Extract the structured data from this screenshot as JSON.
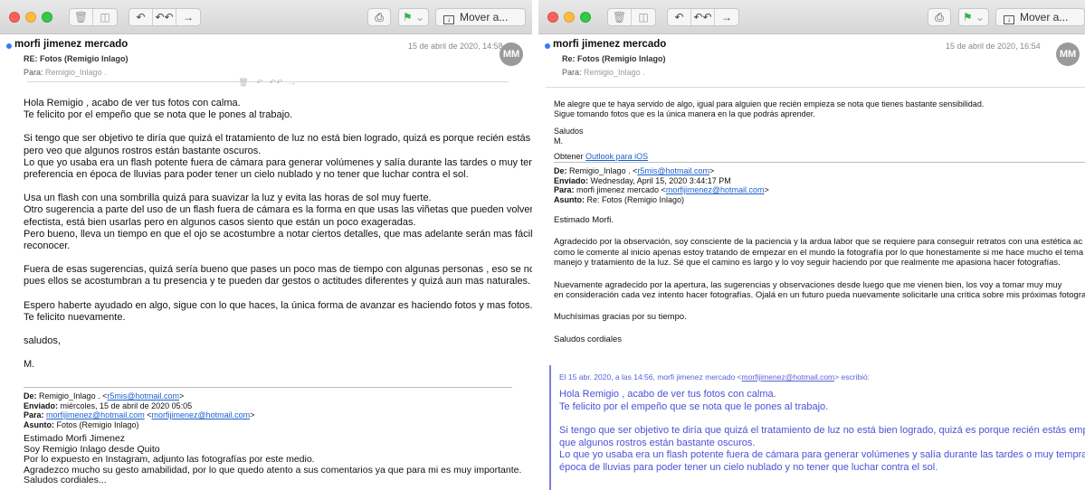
{
  "left": {
    "toolbar": {
      "move_label": "Mover a..."
    },
    "sender": "morfi jimenez mercado",
    "date": "15 de abril de 2020, 14:58",
    "avatar": "MM",
    "subject": "RE: Fotos (Remigio Inlago)",
    "to_label": "Para:",
    "to_name": "Remigio_Inlago .",
    "body": [
      "Hola Remigio , acabo de ver tus fotos con calma.",
      "Te felicito por el empeño que se nota que le pones al trabajo.",
      "",
      "Si tengo que ser objetivo te diría que quizá el tratamiento de luz no está bien logrado, quizá es porque recién estás empezando",
      "pero veo que algunos rostros están bastante oscuros.",
      "Lo que yo usaba era un flash potente fuera de cámara para generar volúmenes y salía durante las tardes o muy temprano, de",
      "preferencia en época de lluvias para poder tener un cielo nublado y no tener que luchar contra el sol.",
      "",
      "Usa un flash con una sombrilla quizá para suavizar la luz y evita las horas de sol muy fuerte.",
      "Otro sugerencia a parte del uso de un flash fuera de cámara es la forma en que usas las viñetas que pueden volver la foto muy",
      "efectista, está bien usarlas pero en algunos casos siento que están un poco exageradas.",
      "Pero bueno, lleva un tiempo en que el ojo se acostumbre a notar ciertos detalles, que mas adelante serán mas fáciles de",
      "reconocer.",
      "",
      "Fuera de esas sugerencias, quizá sería bueno que pases un poco mas de tiempo con algunas personas , eso se nota en las fotos,",
      "pues ellos se acostumbran a tu presencia y te pueden dar gestos o actitudes diferentes y quizá aun mas naturales.",
      "",
      "Espero haberte ayudado en algo, sigue con lo que haces, la única forma de avanzar es haciendo fotos y mas fotos.",
      "Te felicito nuevamente.",
      "",
      "saludos,",
      "",
      "M."
    ],
    "forward": {
      "de_label": "De:",
      "de_name": "Remigio_Inlago . <",
      "de_email": "r5mis@hotmail.com",
      "de_end": ">",
      "enviado_label": "Enviado:",
      "enviado_value": "miércoles, 15 de abril de 2020 05:05",
      "para_label": "Para:",
      "para_email1": "morfijimenez@hotmail.com",
      "para_mid": " <",
      "para_email2": "morfijimenez@hotmail.com",
      "para_end": ">",
      "asunto_label": "Asunto:",
      "asunto_value": "Fotos (Remigio Inlago)",
      "lines": [
        "Estimado Morfi Jimenez",
        "Soy Remigio Inlago desde Quito",
        "Por lo expuesto en Instagram, adjunto las fotografías por este medio.",
        "Agradezco mucho su gesto amabilidad, por lo que quedo atento a sus comentarios ya que para mi es muy importante.",
        "Saludos cordiales..."
      ]
    }
  },
  "right": {
    "toolbar": {
      "move_label": "Mover a..."
    },
    "sender": "morfi jimenez mercado",
    "date": "15 de abril de 2020, 16:54",
    "avatar": "MM",
    "subject": "Re: Fotos (Remigio Inlago)",
    "to_label": "Para:",
    "to_name": "Remigio_Inlago .",
    "intro": [
      "Me alegre que te haya servido de algo, igual para alguien que recién empieza se nota que tienes  bastante sensibilidad.",
      "Sigue tomando fotos que es la única manera en la que podrás aprender.",
      "",
      "Saludos",
      "M."
    ],
    "obtener_label": "Obtener",
    "outlook_link": "Outlook para iOS",
    "forward": {
      "de_label": "De:",
      "de_name": "Remigio_Inlago . <",
      "de_email": "r5mis@hotmail.com",
      "de_end": ">",
      "enviado_label": "Enviado:",
      "enviado_value": "Wednesday, April 15, 2020 3:44:17 PM",
      "para_label": "Para:",
      "para_name": "morfi jimenez mercado <",
      "para_email": "morfijimenez@hotmail.com",
      "para_end": ">",
      "asunto_label": "Asunto:",
      "asunto_value": "Re: Fotos (Remigio Inlago)"
    },
    "reply_lines": [
      "Estimado Morfi.",
      "",
      "Agradecido por la observación, soy consciente de la paciencia y la ardua labor que se requiere  para conseguir retratos con una estética ac",
      "como le comente al inicio apenas estoy tratando de empezar en el mundo la fotografía por lo que honestamente si me hace mucho el tema",
      "manejo y tratamiento de la luz. Sé que el camino es largo y lo voy seguir haciendo por que realmente me apasiona hacer fotografías.",
      "",
      "Nuevamente agradecido por la apertura, las sugerencias y observaciones desde luego que me vienen bien, los voy a tomar muy muy",
      "en consideración cada vez intento hacer fotografías. Ojalá en un futuro pueda nuevamente solicitarle una crítica sobre mis próximas fotogra",
      "",
      "Muchísimas gracias por su tiempo.",
      "",
      "Saludos cordiales"
    ],
    "quote_header": "El 15 abr. 2020, a las 14:56, morfi jimenez mercado <",
    "quote_email": "morfijimenez@hotmail.com",
    "quote_header_end": "> escribió:",
    "quote_lines": [
      "Hola Remigio , acabo de ver tus fotos con calma.",
      "Te felicito por el empeño que se nota que le pones al trabajo.",
      "",
      "Si tengo que ser objetivo te diría que quizá el tratamiento de luz no está bien logrado, quizá es porque recién estás empezando pero",
      "que algunos rostros están bastante oscuros.",
      "Lo que yo usaba era un flash potente fuera de cámara para generar volúmenes y salía durante las tardes o muy temprano, de prefer",
      "época de lluvias para poder tener un cielo nublado y no tener que luchar contra el sol."
    ]
  }
}
